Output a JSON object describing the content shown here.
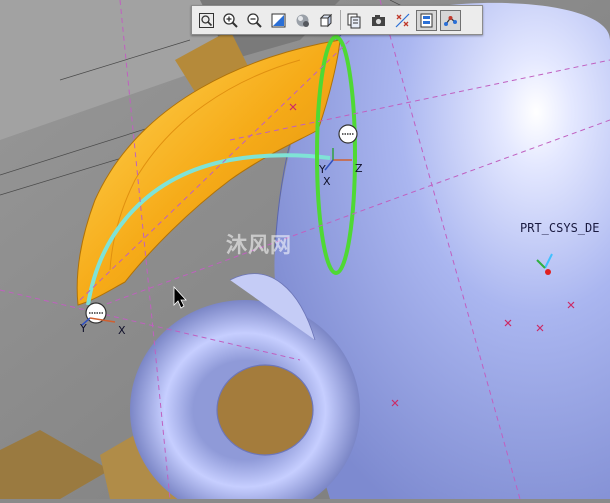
{
  "toolbar": {
    "buttons": [
      {
        "icon": "zoom-fit-icon"
      },
      {
        "icon": "zoom-in-icon"
      },
      {
        "icon": "zoom-out-icon"
      },
      {
        "icon": "repaint-icon"
      },
      {
        "icon": "shading-icon"
      },
      {
        "icon": "saved-view-icon"
      },
      {
        "icon": "layers-icon"
      },
      {
        "icon": "camera-icon"
      },
      {
        "icon": "datum-display-icon"
      },
      {
        "icon": "annotation-display-icon",
        "active": true
      },
      {
        "icon": "spin-center-icon",
        "active": true
      }
    ]
  },
  "viewport": {
    "csys_label": "PRT_CSYS_DE",
    "axis_labels": {
      "y_top": "Y",
      "x_top": "X",
      "z_top": "Z",
      "y_bottom": "Y",
      "x_bottom": "X"
    },
    "watermark_text": "沐风网",
    "colors": {
      "surface_orange": "#f5a516",
      "body_blue": "#a9b5ef",
      "trajectory_cyan": "#7fe3d6",
      "section_green": "#4fd934",
      "datum_magenta": "#c060c0"
    }
  }
}
